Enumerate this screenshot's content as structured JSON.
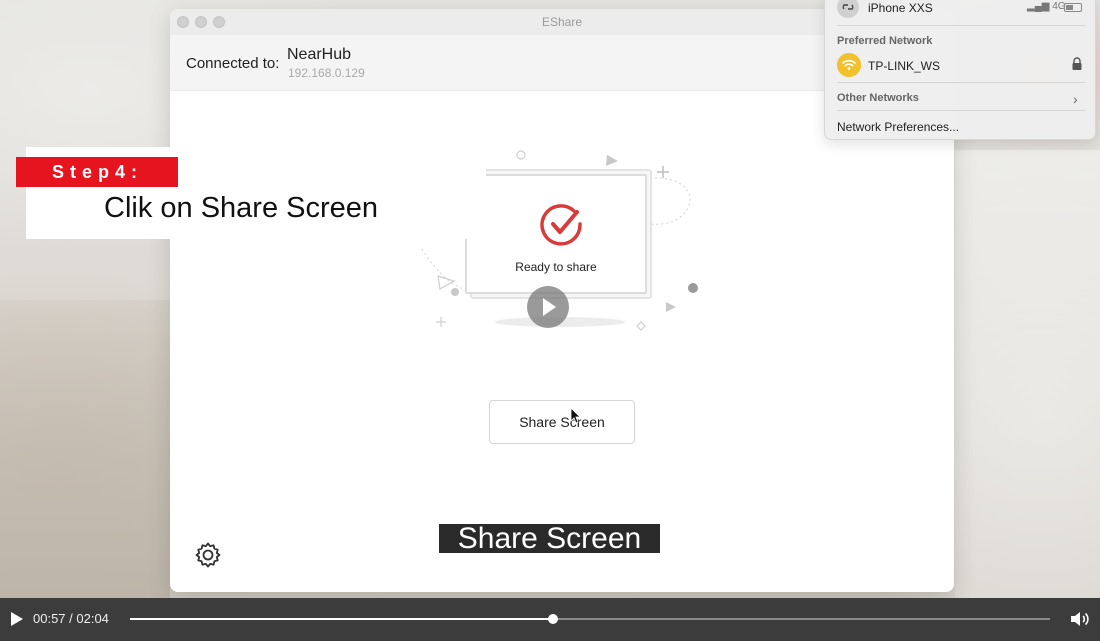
{
  "window": {
    "title": "EShare",
    "connected_label": "Connected to:",
    "device_name": "NearHub",
    "device_ip": "192.168.0.129",
    "status_text": "Ready to share",
    "share_button_label": "Share Screen",
    "accent_color": "#d93a3a"
  },
  "tutorial": {
    "step_label": "Step4:",
    "instruction": "Clik on Share Screen",
    "caption": "Share Screen",
    "step_color": "#e5141f"
  },
  "wifi_menu": {
    "hotspot_name": "iPhone XXS",
    "hotspot_signal": "4G",
    "preferred_heading": "Preferred Network",
    "preferred_network": "TP-LINK_WS",
    "other_networks": "Other Networks",
    "preferences": "Network Preferences..."
  },
  "player": {
    "time": "00:57 / 02:04",
    "progress": 0.46
  }
}
